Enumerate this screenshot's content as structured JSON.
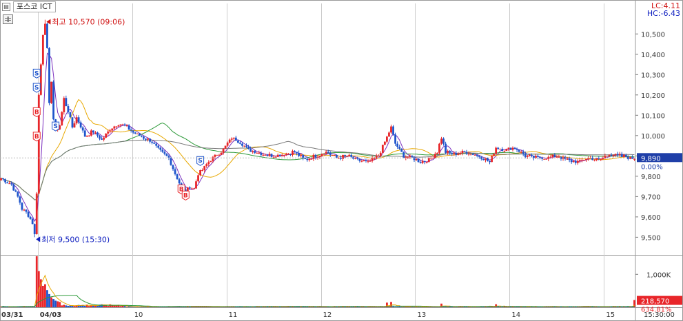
{
  "header": {
    "title": "포스코 ICT"
  },
  "indicators": {
    "lc": "LC:4.11",
    "hc": "HC:-6.43"
  },
  "labels": {
    "high": "최고 10,570 (09:06)",
    "low": "최저 9,500 (15:30)",
    "last_price": "9,890",
    "last_change": "0.00%",
    "last_volume": "218,570",
    "volume_ratio": "634.81%"
  },
  "colors": {
    "up": "#e8262a",
    "down": "#1f55cc",
    "ma_short": "#7b2fbf",
    "ma_mid": "#e8a800",
    "ma_long": "#2e9a3a",
    "ma_longest": "#777777",
    "high_label": "#d01010",
    "low_label": "#1020c0"
  },
  "chart_data": {
    "type": "candlestick",
    "price_axis": {
      "ticks": [
        9500,
        9600,
        9700,
        9800,
        9900,
        10000,
        10100,
        10200,
        10300,
        10400,
        10500
      ],
      "tick_labels": [
        "9,500",
        "9,600",
        "9,700",
        "9,800",
        "9,900",
        "10,000",
        "10,100",
        "10,200",
        "10,300",
        "10,400",
        "10,500"
      ],
      "ylim": [
        9420,
        10650
      ]
    },
    "volume_axis": {
      "ticks": [
        1000000
      ],
      "tick_labels": [
        "1,000K"
      ],
      "ylim": [
        0,
        1550000
      ]
    },
    "x_axis": {
      "tick_labels": [
        "03/31",
        "04/03",
        "10",
        "11",
        "12",
        "13",
        "14",
        "15"
      ],
      "tick_bars": [
        1,
        18,
        63,
        108,
        153,
        198,
        243,
        288
      ],
      "time_label": "15:30:00",
      "bar_count": 303
    },
    "high": 10570,
    "low": 9500,
    "last_price": 9890,
    "price_anchors": [
      [
        0,
        9790
      ],
      [
        5,
        9760
      ],
      [
        8,
        9700
      ],
      [
        10,
        9640
      ],
      [
        13,
        9610
      ],
      [
        15,
        9570
      ],
      [
        16,
        9510
      ],
      [
        17,
        9720
      ],
      [
        18,
        10200
      ],
      [
        19,
        10350
      ],
      [
        20,
        10500
      ],
      [
        21,
        10560
      ],
      [
        22,
        10420
      ],
      [
        23,
        10150
      ],
      [
        24,
        10270
      ],
      [
        25,
        10080
      ],
      [
        26,
        10020
      ],
      [
        28,
        10050
      ],
      [
        30,
        10180
      ],
      [
        32,
        10120
      ],
      [
        34,
        10040
      ],
      [
        36,
        10090
      ],
      [
        40,
        10000
      ],
      [
        44,
        10020
      ],
      [
        48,
        9980
      ],
      [
        52,
        10030
      ],
      [
        56,
        10060
      ],
      [
        60,
        10040
      ],
      [
        64,
        10010
      ],
      [
        68,
        9990
      ],
      [
        72,
        9970
      ],
      [
        76,
        9920
      ],
      [
        80,
        9890
      ],
      [
        84,
        9790
      ],
      [
        86,
        9740
      ],
      [
        88,
        9720
      ],
      [
        90,
        9750
      ],
      [
        92,
        9740
      ],
      [
        94,
        9810
      ],
      [
        96,
        9830
      ],
      [
        98,
        9860
      ],
      [
        102,
        9900
      ],
      [
        106,
        9930
      ],
      [
        110,
        9990
      ],
      [
        114,
        9970
      ],
      [
        118,
        9930
      ],
      [
        125,
        9910
      ],
      [
        130,
        9900
      ],
      [
        135,
        9910
      ],
      [
        140,
        9920
      ],
      [
        145,
        9880
      ],
      [
        150,
        9900
      ],
      [
        155,
        9920
      ],
      [
        160,
        9890
      ],
      [
        165,
        9900
      ],
      [
        170,
        9880
      ],
      [
        175,
        9870
      ],
      [
        180,
        9900
      ],
      [
        184,
        9990
      ],
      [
        186,
        10040
      ],
      [
        188,
        9960
      ],
      [
        192,
        9900
      ],
      [
        196,
        9890
      ],
      [
        200,
        9870
      ],
      [
        204,
        9880
      ],
      [
        208,
        9920
      ],
      [
        210,
        9990
      ],
      [
        212,
        9920
      ],
      [
        216,
        9910
      ],
      [
        220,
        9920
      ],
      [
        225,
        9910
      ],
      [
        230,
        9890
      ],
      [
        233,
        9870
      ],
      [
        236,
        9940
      ],
      [
        240,
        9930
      ],
      [
        245,
        9940
      ],
      [
        250,
        9900
      ],
      [
        255,
        9890
      ],
      [
        260,
        9890
      ],
      [
        265,
        9900
      ],
      [
        270,
        9880
      ],
      [
        275,
        9870
      ],
      [
        280,
        9890
      ],
      [
        285,
        9880
      ],
      [
        290,
        9910
      ],
      [
        295,
        9900
      ],
      [
        300,
        9890
      ],
      [
        302,
        9890
      ]
    ],
    "volume_spikes": [
      [
        17,
        1550000
      ],
      [
        18,
        1100000
      ],
      [
        19,
        850000
      ],
      [
        20,
        650000
      ],
      [
        21,
        700000
      ],
      [
        22,
        520000
      ],
      [
        23,
        400000
      ],
      [
        24,
        300000
      ],
      [
        25,
        250000
      ],
      [
        26,
        200000
      ],
      [
        27,
        180000
      ],
      [
        28,
        160000
      ],
      [
        184,
        140000
      ],
      [
        186,
        160000
      ],
      [
        210,
        110000
      ],
      [
        236,
        90000
      ],
      [
        302,
        218570
      ]
    ],
    "signals": [
      {
        "type": "S",
        "bar": 17,
        "price": 10310
      },
      {
        "type": "S",
        "bar": 17,
        "price": 10240
      },
      {
        "type": "B",
        "bar": 17,
        "price": 10120
      },
      {
        "type": "B",
        "bar": 17,
        "price": 10000
      },
      {
        "type": "S",
        "bar": 26,
        "price": 10050
      },
      {
        "type": "B",
        "bar": 86,
        "price": 9740
      },
      {
        "type": "B",
        "bar": 88,
        "price": 9710
      },
      {
        "type": "S",
        "bar": 95,
        "price": 9880
      }
    ]
  }
}
